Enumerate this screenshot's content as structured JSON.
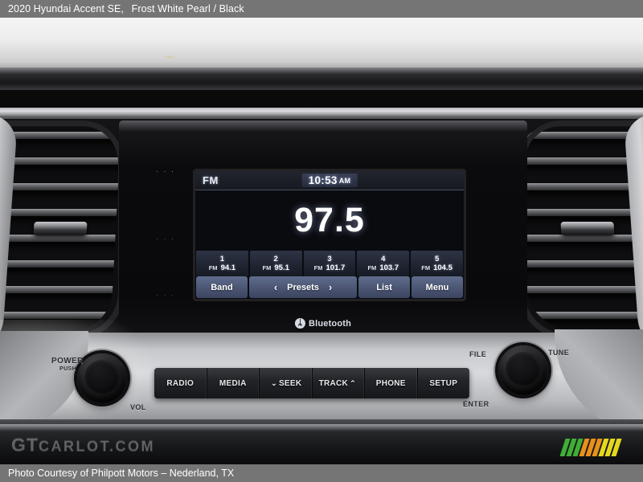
{
  "caption": {
    "vehicle": "2020 Hyundai Accent SE,",
    "colors": "Frost White Pearl / Black"
  },
  "footer": {
    "credit": "Photo Courtesy of Philpott Motors – Nederland, TX"
  },
  "watermark": {
    "prefix": "GT",
    "suffix": "CARLOT.COM"
  },
  "head_unit": {
    "dots": "· · ·",
    "bluetooth": {
      "glyph": "ᛦ",
      "label": "Bluetooth"
    }
  },
  "screen": {
    "band": "FM",
    "clock_time": "10:53",
    "clock_ampm": "AM",
    "frequency": "97.5",
    "presets": [
      {
        "num": "1",
        "band": "FM",
        "freq": "94.1"
      },
      {
        "num": "2",
        "band": "FM",
        "freq": "95.1"
      },
      {
        "num": "3",
        "band": "FM",
        "freq": "101.7"
      },
      {
        "num": "4",
        "band": "FM",
        "freq": "103.7"
      },
      {
        "num": "5",
        "band": "FM",
        "freq": "104.5"
      }
    ],
    "softkeys": {
      "band": "Band",
      "prev_arrow": "‹",
      "presets": "Presets",
      "next_arrow": "›",
      "list": "List",
      "menu": "Menu"
    }
  },
  "controls": {
    "left_knob": {
      "power": "POWER",
      "push": "PUSH",
      "vol": "VOL"
    },
    "right_knob": {
      "file": "FILE",
      "tune": "TUNE",
      "enter": "ENTER"
    },
    "buttons": [
      {
        "label": "RADIO",
        "pre_icon": "",
        "post_icon": ""
      },
      {
        "label": "MEDIA",
        "pre_icon": "",
        "post_icon": ""
      },
      {
        "label": "SEEK",
        "pre_icon": "⌄",
        "post_icon": ""
      },
      {
        "label": "TRACK",
        "pre_icon": "",
        "post_icon": "⌃"
      },
      {
        "label": "PHONE",
        "pre_icon": "",
        "post_icon": ""
      },
      {
        "label": "SETUP",
        "pre_icon": "",
        "post_icon": ""
      }
    ]
  },
  "colors": {
    "caption_bar": "#757575",
    "lcd_background": "#0b0c11",
    "softkey_blue": "#4d5876",
    "accent_green": "#3fae35",
    "accent_orange": "#e8901c",
    "accent_yellow": "#e3d81f"
  }
}
